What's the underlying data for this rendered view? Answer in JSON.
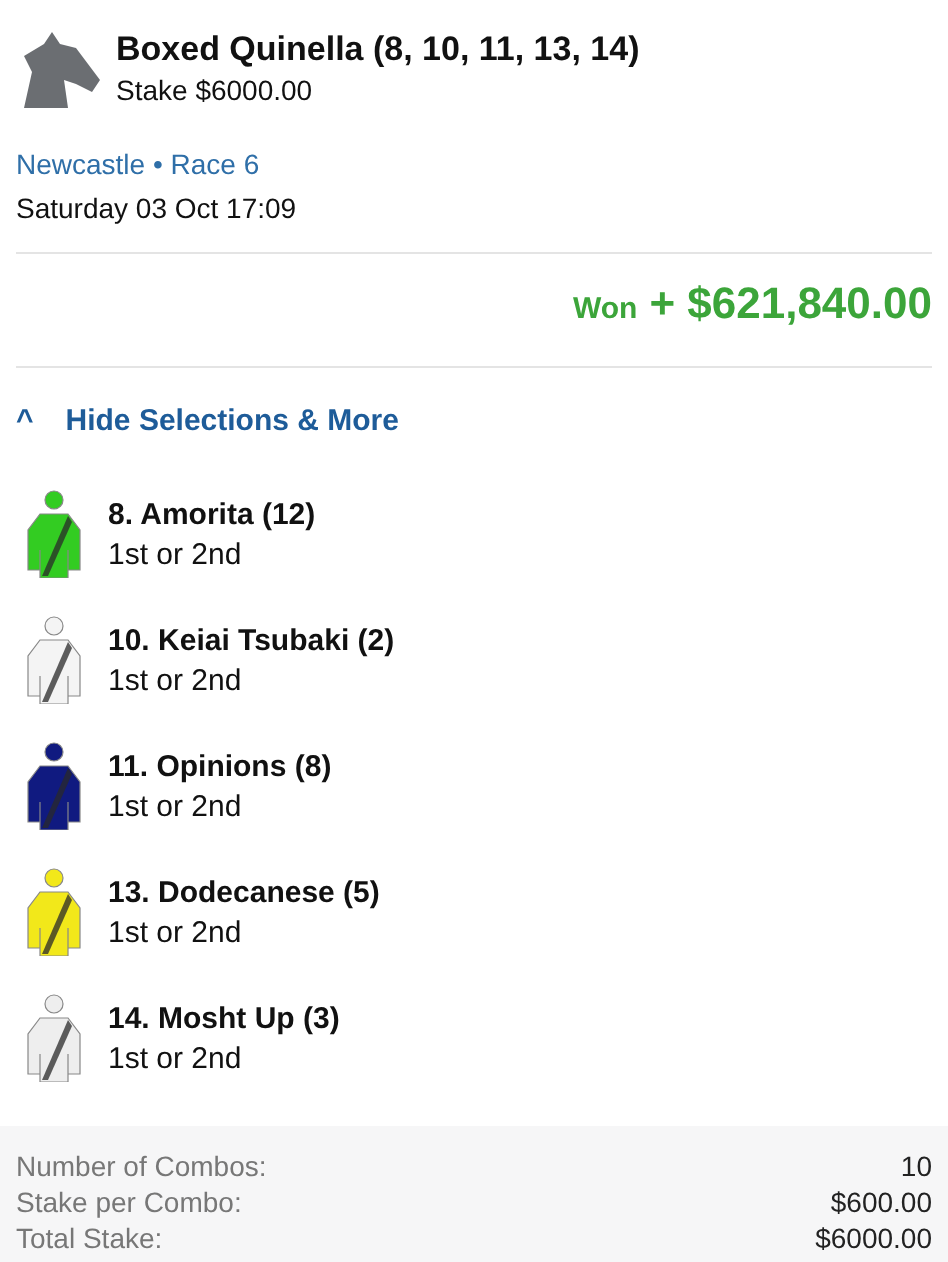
{
  "bet": {
    "title": "Boxed Quinella (8, 10, 11, 13, 14)",
    "stake": "Stake $6000.00",
    "venue": "Newcastle • Race 6",
    "time": "Saturday 03 Oct 17:09"
  },
  "result": {
    "label": "Won",
    "amount": "+ $621,840.00"
  },
  "toggle": {
    "icon": "^",
    "label": "Hide Selections & More"
  },
  "selections": [
    {
      "name": "8. Amorita (12)",
      "position": "1st or 2nd",
      "color": "#33cc22"
    },
    {
      "name": "10. Keiai Tsubaki (2)",
      "position": "1st or 2nd",
      "color": "#f4f4f4"
    },
    {
      "name": "11. Opinions (8)",
      "position": "1st or 2nd",
      "color": "#101a80"
    },
    {
      "name": "13. Dodecanese (5)",
      "position": "1st or 2nd",
      "color": "#f2e81a"
    },
    {
      "name": "14. Mosht Up (3)",
      "position": "1st or 2nd",
      "color": "#eeeeee"
    }
  ],
  "summary": [
    {
      "label": "Number of Combos:",
      "value": "10"
    },
    {
      "label": "Stake per Combo:",
      "value": "$600.00"
    },
    {
      "label": "Total Stake:",
      "value": "$6000.00"
    }
  ]
}
